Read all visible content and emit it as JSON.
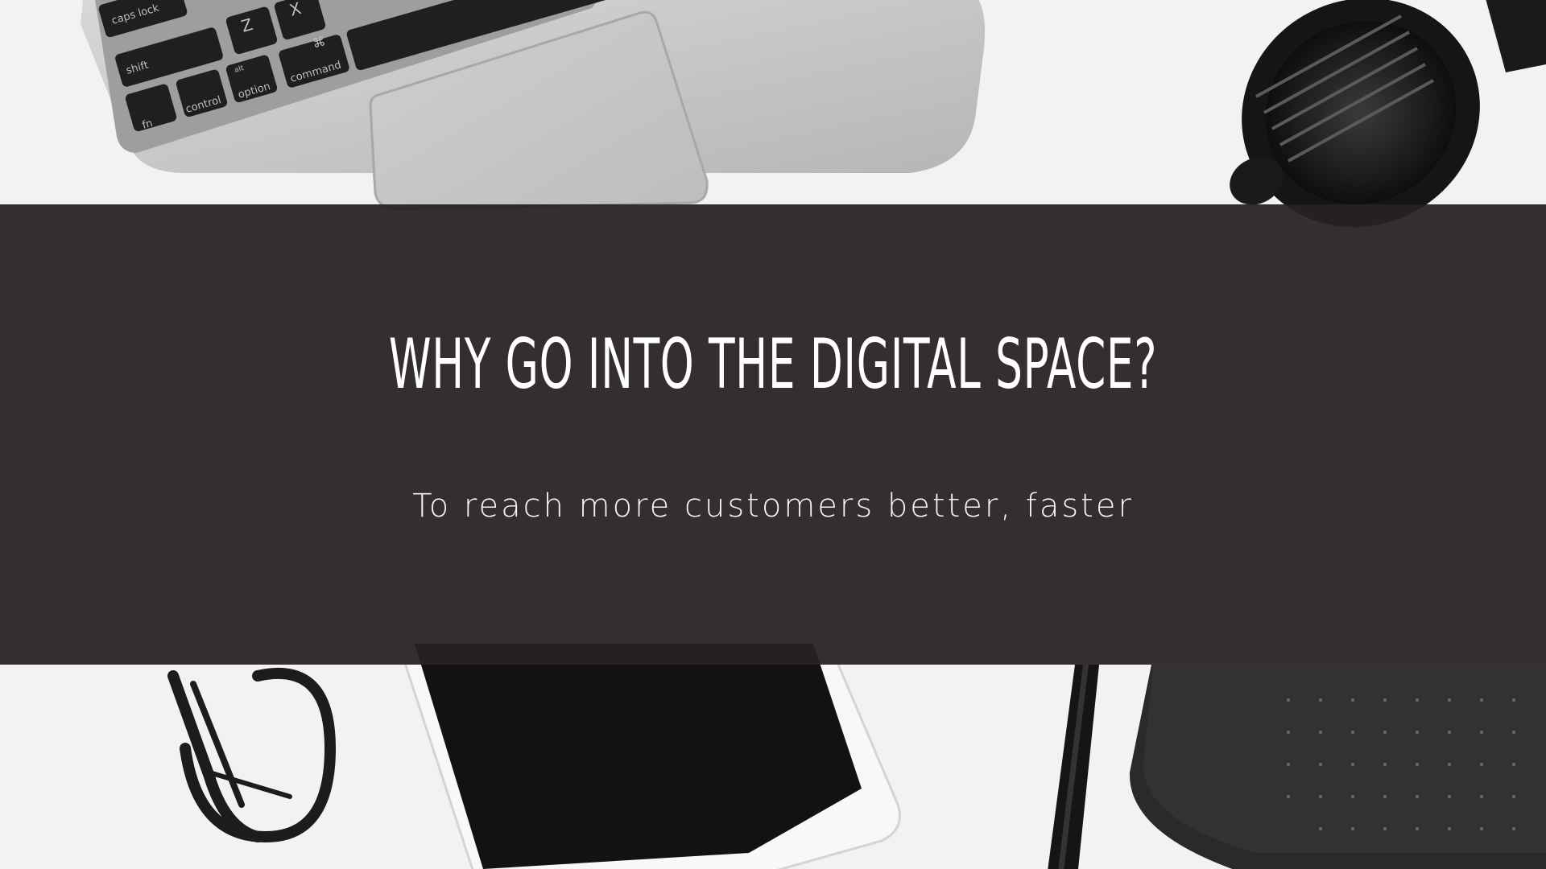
{
  "slide": {
    "headline": "WHY GO INTO THE DIGITAL SPACE?",
    "subheadline": "To reach more customers better, faster"
  },
  "photo": {
    "keys": {
      "caps_lock": "caps lock",
      "shift": "shift",
      "fn": "fn",
      "control": "control",
      "alt": "alt",
      "option": "option",
      "command_symbol": "⌘",
      "command": "command",
      "z": "Z",
      "x": "X"
    }
  },
  "colors": {
    "banner": "#282122",
    "text": "#ffffff",
    "background": "#f3f3f3"
  },
  "icons": [
    "laptop-illustration",
    "camera-lens-illustration",
    "glasses-illustration",
    "tablet-illustration",
    "pen-illustration",
    "notebook-illustration"
  ]
}
